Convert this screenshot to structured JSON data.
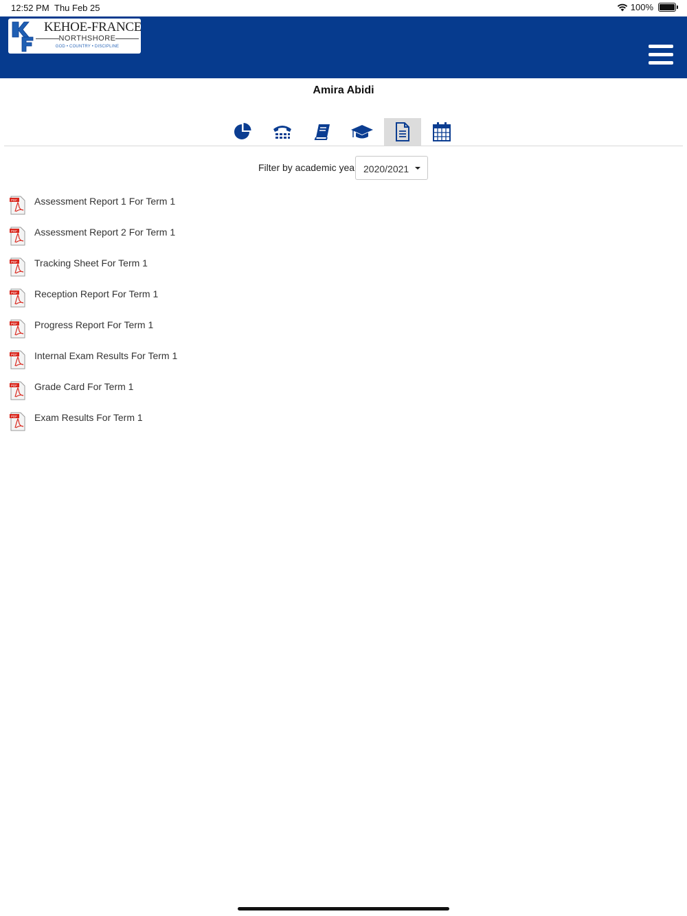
{
  "status": {
    "time": "12:52 PM",
    "date": "Thu Feb 25",
    "battery": "100%"
  },
  "header": {
    "logo": {
      "name": "KEHOE-FRANCE",
      "sub": "NORTHSHORE",
      "motto": "GOD • COUNTRY • DISCIPLINE",
      "mark": "KF"
    },
    "menu_icon": "hamburger-icon"
  },
  "student": {
    "name": "Amira Abidi"
  },
  "tabs": [
    {
      "icon": "pie-chart-icon",
      "active": false
    },
    {
      "icon": "telephone-icon",
      "active": false
    },
    {
      "icon": "book-icon",
      "active": false
    },
    {
      "icon": "graduation-cap-icon",
      "active": false
    },
    {
      "icon": "document-icon",
      "active": true
    },
    {
      "icon": "calendar-icon",
      "active": false
    }
  ],
  "filter": {
    "label": "Filter by academic year",
    "selected": "2020/2021"
  },
  "reports": [
    {
      "label": "Assessment Report 1 For Term 1",
      "icon": "pdf-icon"
    },
    {
      "label": "Assessment Report 2 For Term 1",
      "icon": "pdf-icon"
    },
    {
      "label": "Tracking Sheet For Term 1",
      "icon": "pdf-icon"
    },
    {
      "label": "Reception Report For Term 1",
      "icon": "pdf-icon"
    },
    {
      "label": "Progress Report For Term 1",
      "icon": "pdf-icon"
    },
    {
      "label": "Internal Exam Results For Term 1",
      "icon": "pdf-icon"
    },
    {
      "label": "Grade Card For Term 1",
      "icon": "pdf-icon"
    },
    {
      "label": "Exam Results For Term 1",
      "icon": "pdf-icon"
    }
  ],
  "colors": {
    "brand": "#063b8e",
    "icon_blue": "#0b3d91",
    "pdf_red": "#d9261c"
  }
}
